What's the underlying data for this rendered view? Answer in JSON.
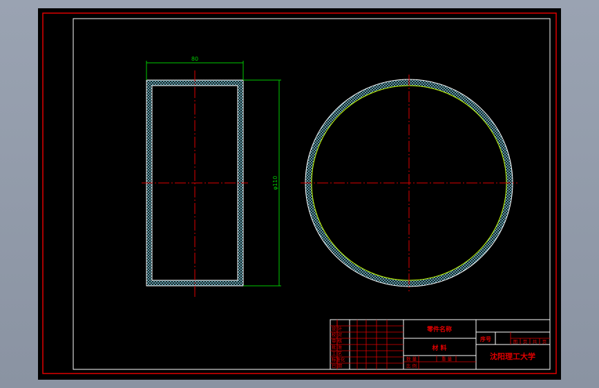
{
  "drawing": {
    "dimension_width": "80",
    "dimension_height": "φ110",
    "colors": {
      "border": "#e00000",
      "outline": "#ffffff",
      "hatch": "#6fb8c8",
      "centerline": "#e00000",
      "dimension": "#00cc00",
      "inner_circle": "#c8ff00"
    }
  },
  "title_block": {
    "part_name": "零件名称",
    "material": "材 料",
    "serial_label": "序号",
    "school": "沈阳理工大学",
    "sheet_labels": [
      "图",
      "页",
      "共",
      "页"
    ],
    "left_col": [
      "设 计",
      "校 对",
      "审 核",
      "批 准",
      "工 艺",
      "标准化",
      "日 期"
    ],
    "bottom_labels": [
      "数 量",
      "比 例",
      "重 量"
    ]
  }
}
